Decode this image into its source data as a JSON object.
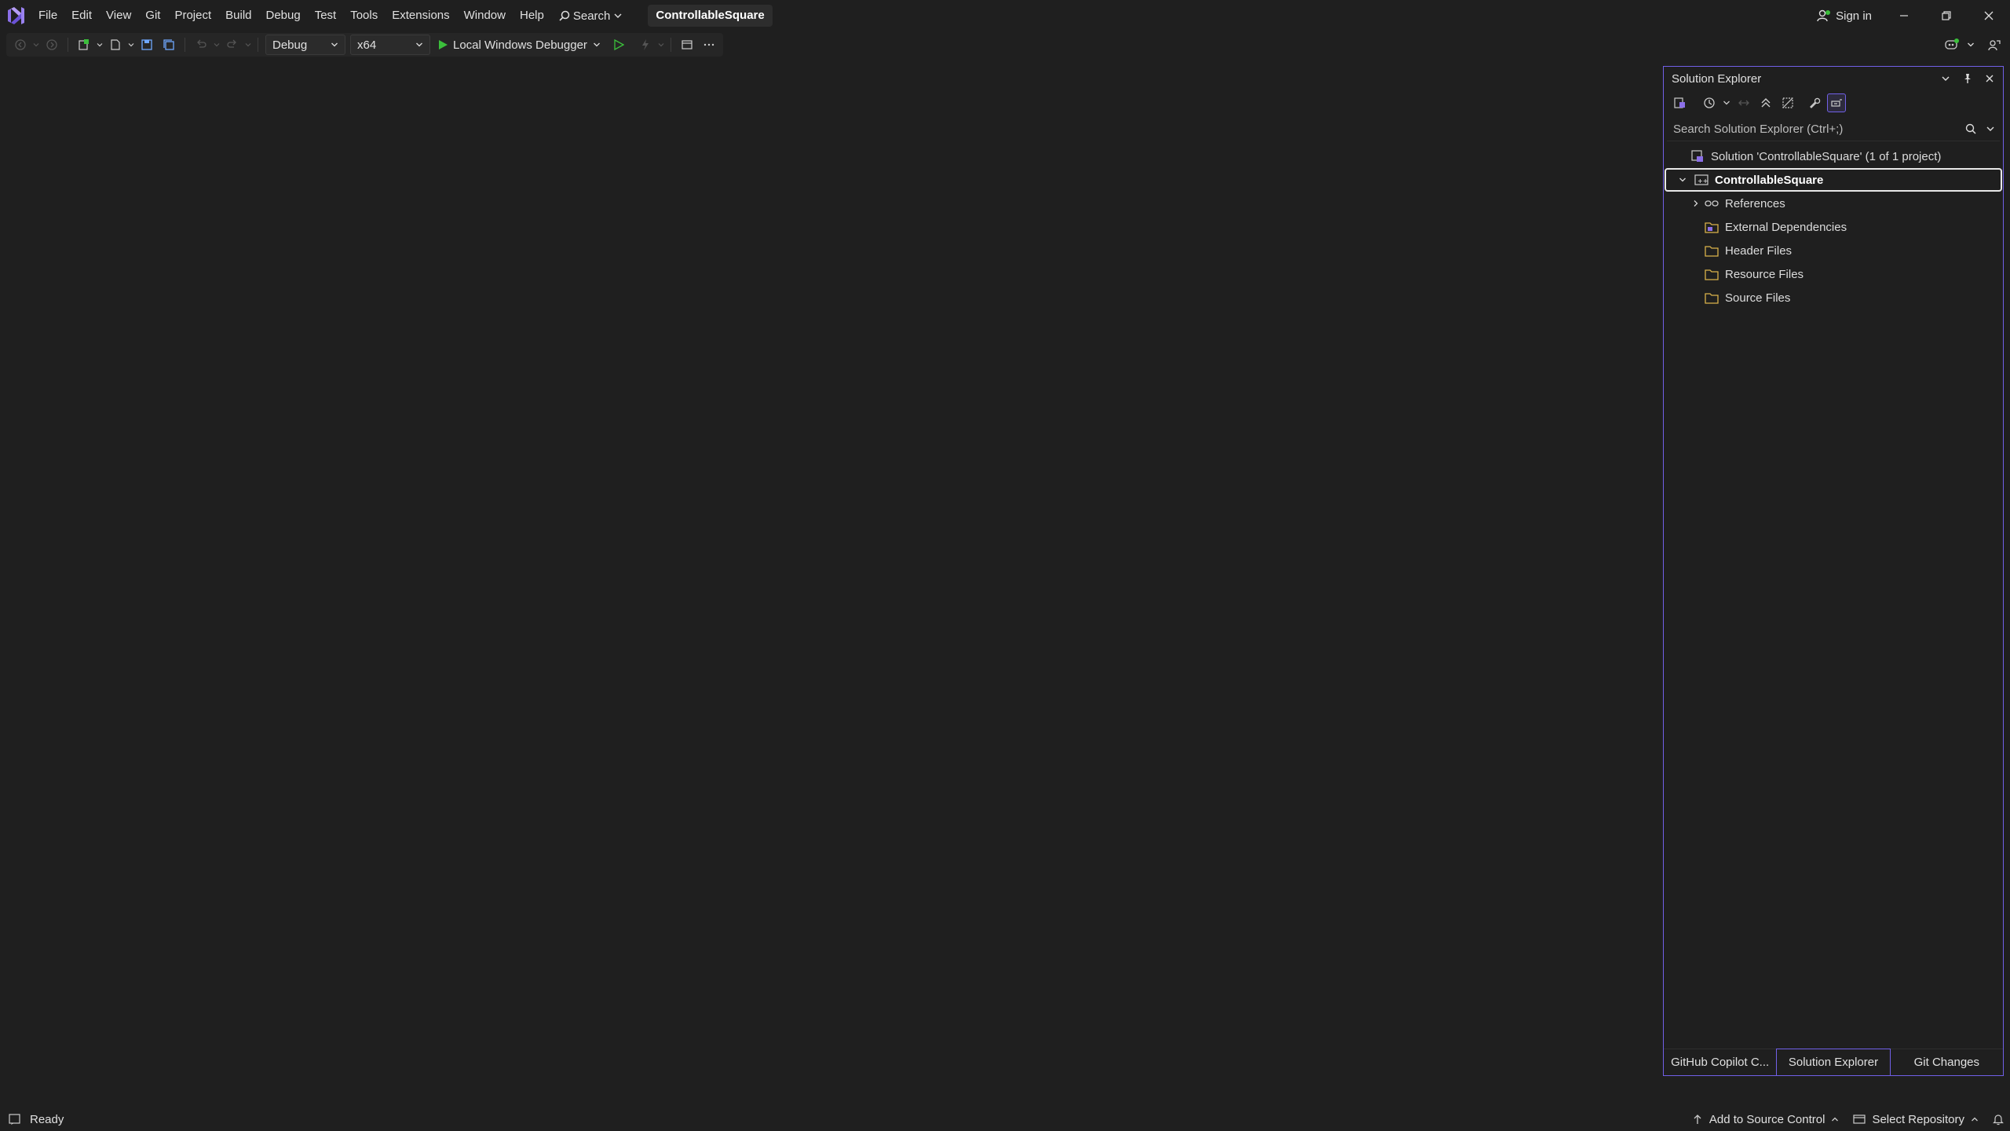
{
  "colors": {
    "accent": "#7160e8",
    "background": "#1f1f1f",
    "run_green": "#3bbf3b",
    "vs_purple": "#8b6fe8"
  },
  "menu": {
    "items": [
      "File",
      "Edit",
      "View",
      "Git",
      "Project",
      "Build",
      "Debug",
      "Test",
      "Tools",
      "Extensions",
      "Window",
      "Help"
    ],
    "search_label": "Search",
    "project_name": "ControllableSquare"
  },
  "title_right": {
    "signin_label": "Sign in"
  },
  "toolbar": {
    "configuration": "Debug",
    "platform": "x64",
    "run_label": "Local Windows Debugger"
  },
  "solution_explorer": {
    "title": "Solution Explorer",
    "search_placeholder": "Search Solution Explorer (Ctrl+;)",
    "solution_label": "Solution 'ControllableSquare' (1 of 1 project)",
    "project_label": "ControllableSquare",
    "children": [
      "References",
      "External Dependencies",
      "Header Files",
      "Resource Files",
      "Source Files"
    ],
    "tabs": [
      "GitHub Copilot C...",
      "Solution Explorer",
      "Git Changes"
    ],
    "active_tab": "Solution Explorer"
  },
  "statusbar": {
    "status": "Ready",
    "add_to_source_control": "Add to Source Control",
    "select_repository": "Select Repository"
  }
}
